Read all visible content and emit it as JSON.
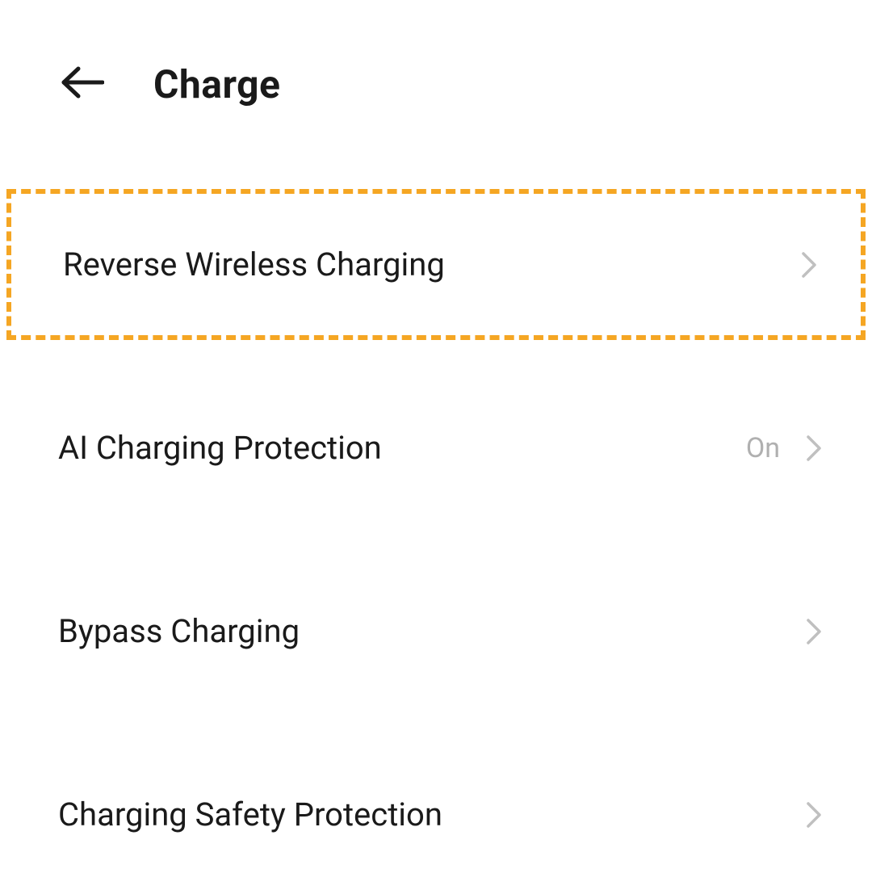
{
  "header": {
    "title": "Charge"
  },
  "settings": {
    "items": [
      {
        "label": "Reverse Wireless Charging",
        "value": "",
        "highlighted": true
      },
      {
        "label": "AI Charging Protection",
        "value": "On",
        "highlighted": false
      },
      {
        "label": "Bypass Charging",
        "value": "",
        "highlighted": false
      },
      {
        "label": "Charging Safety Protection",
        "value": "",
        "highlighted": false
      }
    ]
  },
  "colors": {
    "highlight": "#f5a623",
    "text_primary": "#1a1a1a",
    "text_secondary": "#b0b0b0",
    "chevron": "#c0c0c0"
  }
}
